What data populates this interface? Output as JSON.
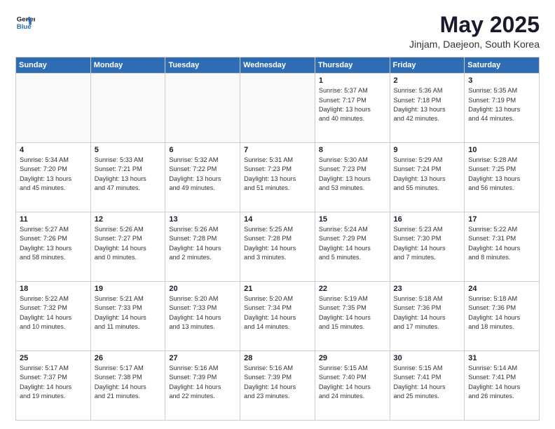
{
  "logo": {
    "line1": "General",
    "line2": "Blue"
  },
  "header": {
    "title": "May 2025",
    "subtitle": "Jinjam, Daejeon, South Korea"
  },
  "days_of_week": [
    "Sunday",
    "Monday",
    "Tuesday",
    "Wednesday",
    "Thursday",
    "Friday",
    "Saturday"
  ],
  "weeks": [
    [
      {
        "day": "",
        "info": ""
      },
      {
        "day": "",
        "info": ""
      },
      {
        "day": "",
        "info": ""
      },
      {
        "day": "",
        "info": ""
      },
      {
        "day": "1",
        "info": "Sunrise: 5:37 AM\nSunset: 7:17 PM\nDaylight: 13 hours\nand 40 minutes."
      },
      {
        "day": "2",
        "info": "Sunrise: 5:36 AM\nSunset: 7:18 PM\nDaylight: 13 hours\nand 42 minutes."
      },
      {
        "day": "3",
        "info": "Sunrise: 5:35 AM\nSunset: 7:19 PM\nDaylight: 13 hours\nand 44 minutes."
      }
    ],
    [
      {
        "day": "4",
        "info": "Sunrise: 5:34 AM\nSunset: 7:20 PM\nDaylight: 13 hours\nand 45 minutes."
      },
      {
        "day": "5",
        "info": "Sunrise: 5:33 AM\nSunset: 7:21 PM\nDaylight: 13 hours\nand 47 minutes."
      },
      {
        "day": "6",
        "info": "Sunrise: 5:32 AM\nSunset: 7:22 PM\nDaylight: 13 hours\nand 49 minutes."
      },
      {
        "day": "7",
        "info": "Sunrise: 5:31 AM\nSunset: 7:23 PM\nDaylight: 13 hours\nand 51 minutes."
      },
      {
        "day": "8",
        "info": "Sunrise: 5:30 AM\nSunset: 7:23 PM\nDaylight: 13 hours\nand 53 minutes."
      },
      {
        "day": "9",
        "info": "Sunrise: 5:29 AM\nSunset: 7:24 PM\nDaylight: 13 hours\nand 55 minutes."
      },
      {
        "day": "10",
        "info": "Sunrise: 5:28 AM\nSunset: 7:25 PM\nDaylight: 13 hours\nand 56 minutes."
      }
    ],
    [
      {
        "day": "11",
        "info": "Sunrise: 5:27 AM\nSunset: 7:26 PM\nDaylight: 13 hours\nand 58 minutes."
      },
      {
        "day": "12",
        "info": "Sunrise: 5:26 AM\nSunset: 7:27 PM\nDaylight: 14 hours\nand 0 minutes."
      },
      {
        "day": "13",
        "info": "Sunrise: 5:26 AM\nSunset: 7:28 PM\nDaylight: 14 hours\nand 2 minutes."
      },
      {
        "day": "14",
        "info": "Sunrise: 5:25 AM\nSunset: 7:28 PM\nDaylight: 14 hours\nand 3 minutes."
      },
      {
        "day": "15",
        "info": "Sunrise: 5:24 AM\nSunset: 7:29 PM\nDaylight: 14 hours\nand 5 minutes."
      },
      {
        "day": "16",
        "info": "Sunrise: 5:23 AM\nSunset: 7:30 PM\nDaylight: 14 hours\nand 7 minutes."
      },
      {
        "day": "17",
        "info": "Sunrise: 5:22 AM\nSunset: 7:31 PM\nDaylight: 14 hours\nand 8 minutes."
      }
    ],
    [
      {
        "day": "18",
        "info": "Sunrise: 5:22 AM\nSunset: 7:32 PM\nDaylight: 14 hours\nand 10 minutes."
      },
      {
        "day": "19",
        "info": "Sunrise: 5:21 AM\nSunset: 7:33 PM\nDaylight: 14 hours\nand 11 minutes."
      },
      {
        "day": "20",
        "info": "Sunrise: 5:20 AM\nSunset: 7:33 PM\nDaylight: 14 hours\nand 13 minutes."
      },
      {
        "day": "21",
        "info": "Sunrise: 5:20 AM\nSunset: 7:34 PM\nDaylight: 14 hours\nand 14 minutes."
      },
      {
        "day": "22",
        "info": "Sunrise: 5:19 AM\nSunset: 7:35 PM\nDaylight: 14 hours\nand 15 minutes."
      },
      {
        "day": "23",
        "info": "Sunrise: 5:18 AM\nSunset: 7:36 PM\nDaylight: 14 hours\nand 17 minutes."
      },
      {
        "day": "24",
        "info": "Sunrise: 5:18 AM\nSunset: 7:36 PM\nDaylight: 14 hours\nand 18 minutes."
      }
    ],
    [
      {
        "day": "25",
        "info": "Sunrise: 5:17 AM\nSunset: 7:37 PM\nDaylight: 14 hours\nand 19 minutes."
      },
      {
        "day": "26",
        "info": "Sunrise: 5:17 AM\nSunset: 7:38 PM\nDaylight: 14 hours\nand 21 minutes."
      },
      {
        "day": "27",
        "info": "Sunrise: 5:16 AM\nSunset: 7:39 PM\nDaylight: 14 hours\nand 22 minutes."
      },
      {
        "day": "28",
        "info": "Sunrise: 5:16 AM\nSunset: 7:39 PM\nDaylight: 14 hours\nand 23 minutes."
      },
      {
        "day": "29",
        "info": "Sunrise: 5:15 AM\nSunset: 7:40 PM\nDaylight: 14 hours\nand 24 minutes."
      },
      {
        "day": "30",
        "info": "Sunrise: 5:15 AM\nSunset: 7:41 PM\nDaylight: 14 hours\nand 25 minutes."
      },
      {
        "day": "31",
        "info": "Sunrise: 5:14 AM\nSunset: 7:41 PM\nDaylight: 14 hours\nand 26 minutes."
      }
    ]
  ]
}
